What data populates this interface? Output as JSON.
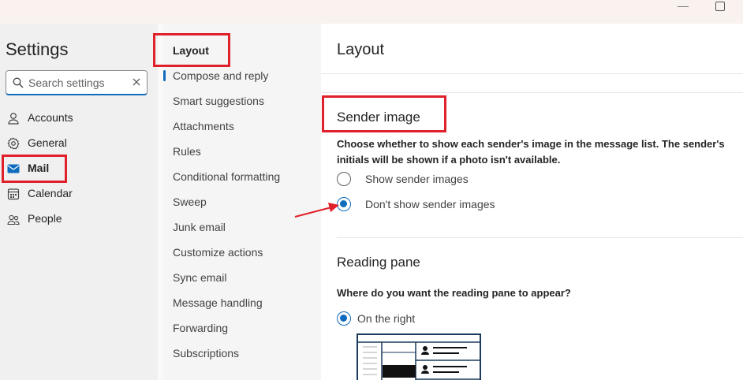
{
  "window": {
    "minimize_icon": "minimize-icon",
    "maximize_icon": "maximize-icon"
  },
  "leftnav": {
    "title": "Settings",
    "search": {
      "placeholder": "Search settings",
      "value": ""
    },
    "items": [
      {
        "label": "Accounts",
        "icon": "person-icon"
      },
      {
        "label": "General",
        "icon": "gear-icon"
      },
      {
        "label": "Mail",
        "icon": "mail-icon",
        "selected": true
      },
      {
        "label": "Calendar",
        "icon": "calendar-icon"
      },
      {
        "label": "People",
        "icon": "people-icon"
      }
    ]
  },
  "midnav": {
    "items": [
      {
        "label": "Layout",
        "selected": true
      },
      {
        "label": "Compose and reply"
      },
      {
        "label": "Smart suggestions"
      },
      {
        "label": "Attachments"
      },
      {
        "label": "Rules"
      },
      {
        "label": "Conditional formatting"
      },
      {
        "label": "Sweep"
      },
      {
        "label": "Junk email"
      },
      {
        "label": "Customize actions"
      },
      {
        "label": "Sync email"
      },
      {
        "label": "Message handling"
      },
      {
        "label": "Forwarding"
      },
      {
        "label": "Subscriptions"
      }
    ]
  },
  "content": {
    "title": "Layout",
    "sender_image": {
      "heading": "Sender image",
      "description": "Choose whether to show each sender's image in the message list. The sender's initials will be shown if a photo isn't available.",
      "options": [
        {
          "label": "Show sender images",
          "checked": false
        },
        {
          "label": "Don't show sender images",
          "checked": true
        }
      ]
    },
    "reading_pane": {
      "heading": "Reading pane",
      "description": "Where do you want the reading pane to appear?",
      "options": [
        {
          "label": "On the right",
          "checked": true
        }
      ]
    }
  },
  "colors": {
    "accent": "#0f6cbd",
    "annotation": "#e0202a"
  }
}
